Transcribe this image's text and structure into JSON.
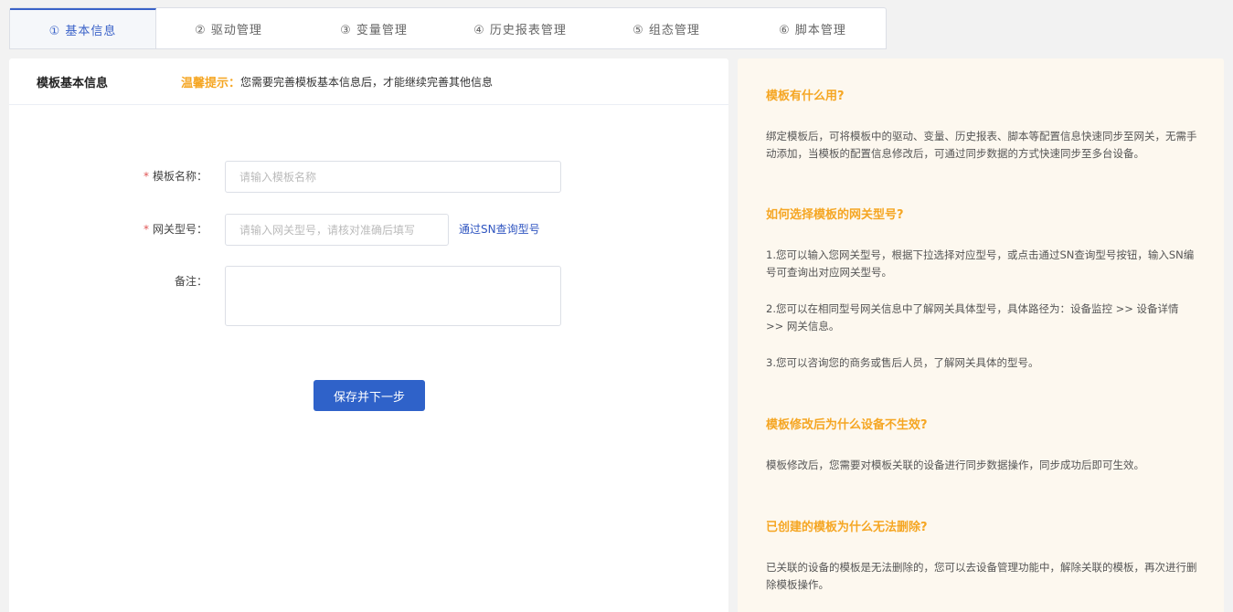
{
  "tabs": [
    {
      "label": "① 基本信息",
      "active": true
    },
    {
      "label": "② 驱动管理",
      "active": false
    },
    {
      "label": "③ 变量管理",
      "active": false
    },
    {
      "label": "④ 历史报表管理",
      "active": false
    },
    {
      "label": "⑤ 组态管理",
      "active": false
    },
    {
      "label": "⑥ 脚本管理",
      "active": false
    }
  ],
  "form": {
    "title": "模板基本信息",
    "tip_label": "温馨提示：",
    "tip_text": "您需要完善模板基本信息后，才能继续完善其他信息",
    "required_mark": "*",
    "name_label": "模板名称：",
    "name_placeholder": "请输入模板名称",
    "model_label": "网关型号：",
    "model_placeholder": "请输入网关型号，请核对准确后填写",
    "sn_link": "通过SN查询型号",
    "remark_label": "备注：",
    "save_button": "保存并下一步"
  },
  "faq": [
    {
      "q": "模板有什么用?",
      "a": [
        "绑定模板后，可将模板中的驱动、变量、历史报表、脚本等配置信息快速同步至网关，无需手动添加，当模板的配置信息修改后，可通过同步数据的方式快速同步至多台设备。"
      ]
    },
    {
      "q": "如何选择模板的网关型号?",
      "a": [
        "1.您可以输入您网关型号，根据下拉选择对应型号，或点击通过SN查询型号按钮，输入SN编号可查询出对应网关型号。",
        "2.您可以在相同型号网关信息中了解网关具体型号，具体路径为：设备监控 >> 设备详情 >> 网关信息。",
        "3.您可以咨询您的商务或售后人员，了解网关具体的型号。"
      ]
    },
    {
      "q": "模板修改后为什么设备不生效?",
      "a": [
        "模板修改后，您需要对模板关联的设备进行同步数据操作，同步成功后即可生效。"
      ]
    },
    {
      "q": "已创建的模板为什么无法删除?",
      "a": [
        "已关联的设备的模板是无法删除的，您可以去设备管理功能中，解除关联的模板，再次进行删除模板操作。"
      ]
    }
  ]
}
